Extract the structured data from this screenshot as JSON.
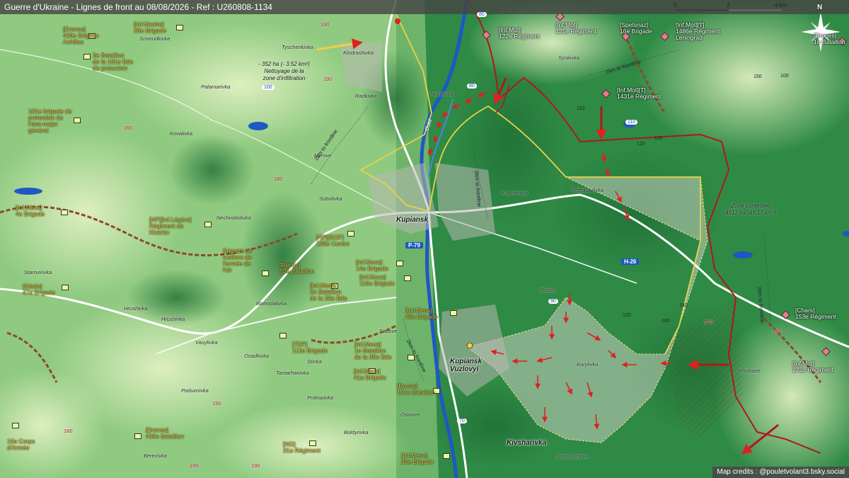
{
  "header": {
    "title": "Guerre d'Ukraine - Lignes de front au 08/08/2026 - Ref : U260808-1134"
  },
  "scale": {
    "ticks": [
      "0",
      "2",
      "4 km"
    ]
  },
  "compass": {
    "label": "N"
  },
  "credits": "Map credits : @pouletvolant3.bsky.social",
  "colors": {
    "ukr_units": "#f3cc44",
    "ru_front": "#b01818",
    "yellow_line": "#e8d24a",
    "water": "#1f57c4"
  },
  "cities": {
    "kupiansk": "Kupiansk",
    "vuzlovyi": "Kupiansk\nVuzlovyi",
    "kivsharivka": "Kivsharivka"
  },
  "towns": {
    "tyschenkivka": "Tyschenkivka",
    "kindrashivka": "Kindrashivka",
    "radkivka": "Radkivka",
    "smorodkivka": "Smorodkivka",
    "palamarivka": "Palamarivka",
    "kovalivka": "Kovalivka",
    "myrove": "Myrove",
    "holubivka": "Holubivka",
    "synkivka": "Synkivka",
    "petropavlivka": "Petropavlivka",
    "kucherivka": "Kucherivka",
    "sobolivka": "Sobolivka",
    "nechvolodivka": "Nechvolodivka",
    "starovirivka": "Starovirivka",
    "blahodativka": "Blahodativka",
    "hrushivka1": "Hrushivka",
    "hrushivka2": "Hrushivka",
    "vasylivka": "Vasylivka",
    "osadkivka": "Osadkivka",
    "stinka": "Stinka",
    "tamarhanivka": "Tamarhanivka",
    "poduvnivka": "Poduvnivka",
    "prokopivka": "Prokopivka",
    "osinove": "Osinove",
    "boldyrivka": "Boldyrivka",
    "berezivka": "Berezivka",
    "sadove": "Sadove",
    "podoly": "Podoly",
    "kurylivka": "Kurylivka",
    "pischane": "Pischane",
    "novoosynove": "Novoosynove"
  },
  "notes": {
    "infiltration": "- 352 ha (- 3.52 km²)\nNettoyage de la\nzone d'infiltration",
    "contested": "Zone contestée\n4517 ha (45.17 km²)"
  },
  "front_labels": {
    "f1": "2km to frontline",
    "f2": "2km to frontline",
    "f3": "2km to frontline",
    "f4": "2km to frontline",
    "f5": "2km to frontline"
  },
  "river": "Oskil",
  "roads": {
    "p79": "P-79",
    "h26": "H-26"
  },
  "road_numbers": [
    "100",
    "80",
    "110",
    "80",
    "70",
    "90"
  ],
  "elevations_red": [
    "190",
    "180",
    "200",
    "180",
    "190",
    "190",
    "170",
    "180",
    "190",
    "190",
    "180",
    "200"
  ],
  "elevations_black": [
    "120",
    "130",
    "110",
    "120",
    "100",
    "140",
    "150",
    "160",
    "170",
    "110",
    "130",
    "140",
    "120",
    "160",
    "170",
    "150"
  ],
  "ukr_units": {
    "u1": "[Drones]\n429e Brigade\nAchilles",
    "u2": "[Inf.Marine]\n38e Brigade",
    "u3": "2e Bataillon\nde la 101e Bde\nde protection",
    "u4": "101e brigade de\nprotection de\nl'état-major\ngénéral",
    "u5": "[Inf.Meca]\n4e Brigade",
    "u6": "[NP][Inf.Légère]\nRégiment de\nKharkiv",
    "u7": "[NP][SOF]\n138e Centre",
    "u8": "Brigade de\nfusiliers de\nl'armée de\nl'air",
    "u9": "[Recon]\n52e Bataillon",
    "u10": "[Inf.Meca]\n14e Brigade",
    "u11": "[Inf.Meca]\n116e Brigade",
    "u12": "[Génie]\n47e Brigade",
    "u13": "[Inf.Meca]\n2e Bataillon\nde la 30e Bde",
    "u14": "[Inf.Meca]\n43e Brigade",
    "u15": "[TDF]\n112e Brigade",
    "u16": "[Inf.Meca]\n1e Bataillon\nde la 30e Bde",
    "u17": "[Inf.Meca]\n41e Brigade",
    "u18": "[Recon]\n151e Bataillon",
    "u19": "10e Corps\nd'Armée",
    "u20": "[Drones]\n430e Bataillon",
    "u21": "[NG]\n31e Régiment",
    "u22": "[Inf.Meca]\n33e Brigade"
  },
  "ru_units": {
    "r1": "[Inf.Mot]\n122e Régiment",
    "r2": "[Inf.Mot]\n121e Régiment",
    "r3": "[Spetsnaz]\n16e Brigade",
    "r4": "[Inf.Mot][T]\n1486e Régiment\nLeningrad",
    "r5": "[Inf.Mot][T]\n1431e Régiment",
    "r6": "[Chars]\n153e Régiment",
    "r7": "[Inf.Mot]\n272e Régiment",
    "r8": "[Drones]\n1e Bataillon"
  }
}
